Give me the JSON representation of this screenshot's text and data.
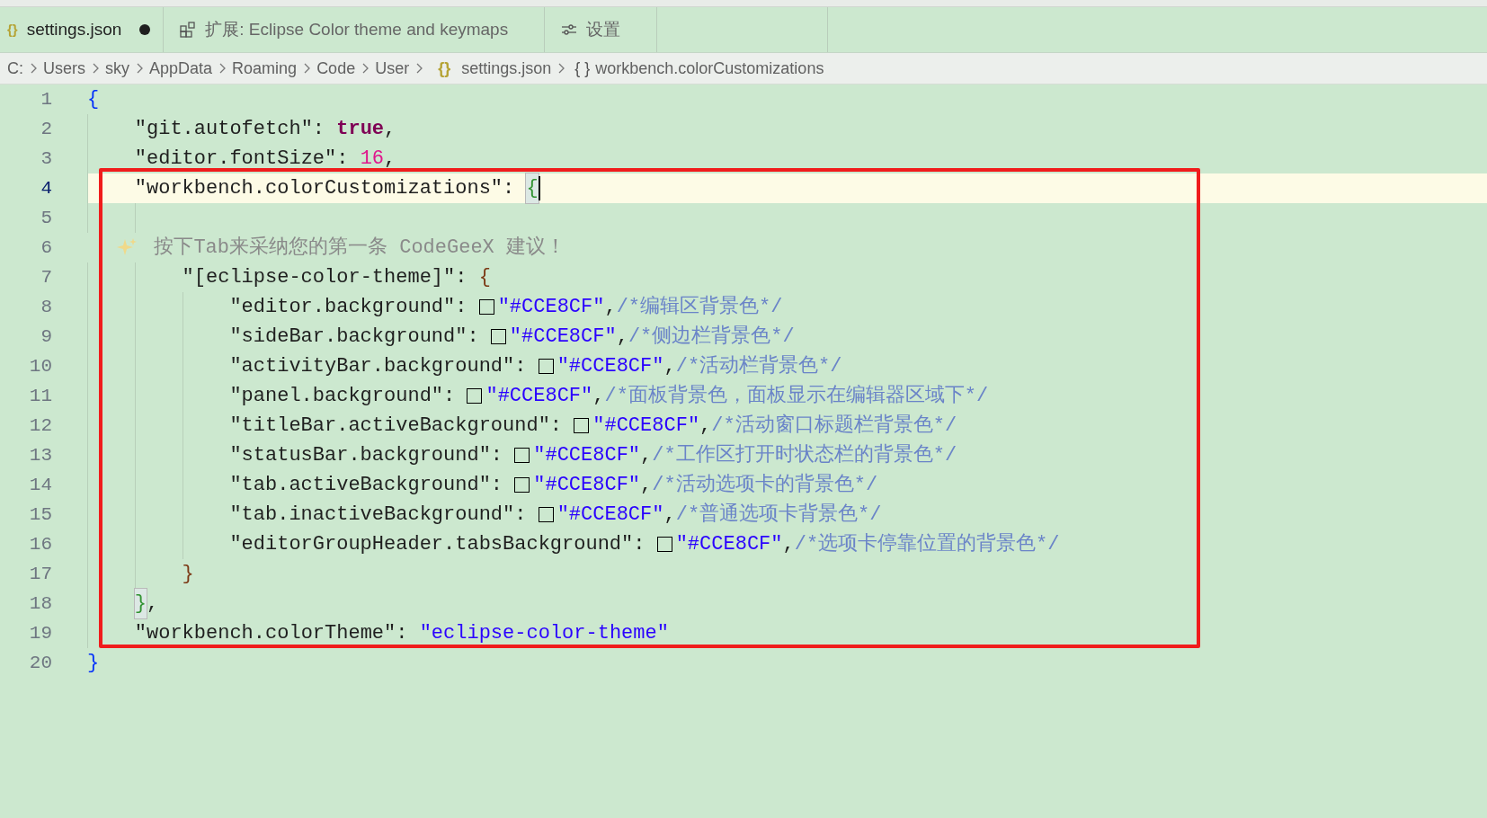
{
  "tabs": [
    {
      "kind": "file",
      "icon_text": "{}",
      "label": "settings.json",
      "selected": true,
      "modified": true
    },
    {
      "kind": "extension",
      "label": "扩展: Eclipse Color theme and keymaps",
      "selected": false,
      "modified": false
    },
    {
      "kind": "settings",
      "label": "设置",
      "selected": false,
      "modified": false
    }
  ],
  "breadcrumb": [
    {
      "label": "C:"
    },
    {
      "label": "Users"
    },
    {
      "label": "sky"
    },
    {
      "label": "AppData"
    },
    {
      "label": "Roaming"
    },
    {
      "label": "Code"
    },
    {
      "label": "User"
    },
    {
      "icon_text": "{}",
      "label": "settings.json"
    },
    {
      "icon_text": "{ }",
      "label": "workbench.colorCustomizations"
    }
  ],
  "lines": [
    {
      "number": "1",
      "kind": "root",
      "current": false,
      "tokens": [
        {
          "kind": "brace-outer",
          "text": "{",
          "matched": false
        }
      ]
    },
    {
      "number": "2",
      "kind": "member",
      "current": false,
      "tokens": [
        {
          "kind": "key",
          "text": "\"git.autofetch\""
        },
        {
          "kind": "punct",
          "text": ": "
        },
        {
          "kind": "bool",
          "text": "true"
        },
        {
          "kind": "punct",
          "text": ","
        }
      ]
    },
    {
      "number": "3",
      "kind": "member",
      "current": false,
      "tokens": [
        {
          "kind": "key",
          "text": "\"editor.fontSize\""
        },
        {
          "kind": "punct",
          "text": ": "
        },
        {
          "kind": "number",
          "text": "16"
        },
        {
          "kind": "punct",
          "text": ","
        }
      ]
    },
    {
      "number": "4",
      "kind": "member",
      "current": true,
      "tokens": [
        {
          "kind": "key",
          "text": "\"workbench.colorCustomizations\""
        },
        {
          "kind": "punct",
          "text": ": "
        },
        {
          "kind": "brace-mid",
          "text": "{",
          "matched": true
        }
      ]
    },
    {
      "number": "5",
      "kind": "nested",
      "current": false
    },
    {
      "number": "6",
      "kind": "suggestion",
      "current": false,
      "tokens": [
        {
          "kind": "sparkle"
        },
        {
          "kind": "ghost",
          "text": "按下Tab来采纳您的第一条 CodeGeeX 建议！"
        }
      ]
    },
    {
      "number": "7",
      "kind": "nested",
      "current": false,
      "tokens": [
        {
          "kind": "key",
          "text": "\"[eclipse-color-theme]\""
        },
        {
          "kind": "punct",
          "text": ": "
        },
        {
          "kind": "brace-inner",
          "text": "{",
          "matched": false
        }
      ]
    },
    {
      "number": "8",
      "kind": "inner",
      "current": false,
      "tokens": [
        {
          "kind": "key",
          "text": "\"editor.background\""
        },
        {
          "kind": "punct",
          "text": ": "
        },
        {
          "kind": "swatch",
          "color": "#cce8cf"
        },
        {
          "kind": "string",
          "text": "\"#CCE8CF\""
        },
        {
          "kind": "punct",
          "text": ","
        },
        {
          "kind": "comment",
          "text": "/*编辑区背景色*/"
        }
      ]
    },
    {
      "number": "9",
      "kind": "inner",
      "current": false,
      "tokens": [
        {
          "kind": "key",
          "text": "\"sideBar.background\""
        },
        {
          "kind": "punct",
          "text": ": "
        },
        {
          "kind": "swatch",
          "color": "#cce8cf"
        },
        {
          "kind": "string",
          "text": "\"#CCE8CF\""
        },
        {
          "kind": "punct",
          "text": ","
        },
        {
          "kind": "comment",
          "text": "/*侧边栏背景色*/"
        }
      ]
    },
    {
      "number": "10",
      "kind": "inner",
      "current": false,
      "tokens": [
        {
          "kind": "key",
          "text": "\"activityBar.background\""
        },
        {
          "kind": "punct",
          "text": ": "
        },
        {
          "kind": "swatch",
          "color": "#cce8cf"
        },
        {
          "kind": "string",
          "text": "\"#CCE8CF\""
        },
        {
          "kind": "punct",
          "text": ","
        },
        {
          "kind": "comment",
          "text": "/*活动栏背景色*/"
        }
      ]
    },
    {
      "number": "11",
      "kind": "inner",
      "current": false,
      "tokens": [
        {
          "kind": "key",
          "text": "\"panel.background\""
        },
        {
          "kind": "punct",
          "text": ": "
        },
        {
          "kind": "swatch",
          "color": "#cce8cf"
        },
        {
          "kind": "string",
          "text": "\"#CCE8CF\""
        },
        {
          "kind": "punct",
          "text": ","
        },
        {
          "kind": "comment",
          "text": "/*面板背景色，面板显示在编辑器区域下*/"
        }
      ]
    },
    {
      "number": "12",
      "kind": "inner",
      "current": false,
      "tokens": [
        {
          "kind": "key",
          "text": "\"titleBar.activeBackground\""
        },
        {
          "kind": "punct",
          "text": ": "
        },
        {
          "kind": "swatch",
          "color": "#cce8cf"
        },
        {
          "kind": "string",
          "text": "\"#CCE8CF\""
        },
        {
          "kind": "punct",
          "text": ","
        },
        {
          "kind": "comment",
          "text": "/*活动窗口标题栏背景色*/"
        }
      ]
    },
    {
      "number": "13",
      "kind": "inner",
      "current": false,
      "tokens": [
        {
          "kind": "key",
          "text": "\"statusBar.background\""
        },
        {
          "kind": "punct",
          "text": ": "
        },
        {
          "kind": "swatch",
          "color": "#cce8cf"
        },
        {
          "kind": "string",
          "text": "\"#CCE8CF\""
        },
        {
          "kind": "punct",
          "text": ","
        },
        {
          "kind": "comment",
          "text": "/*工作区打开时状态栏的背景色*/"
        }
      ]
    },
    {
      "number": "14",
      "kind": "inner",
      "current": false,
      "tokens": [
        {
          "kind": "key",
          "text": "\"tab.activeBackground\""
        },
        {
          "kind": "punct",
          "text": ": "
        },
        {
          "kind": "swatch",
          "color": "#cce8cf"
        },
        {
          "kind": "string",
          "text": "\"#CCE8CF\""
        },
        {
          "kind": "punct",
          "text": ","
        },
        {
          "kind": "comment",
          "text": "/*活动选项卡的背景色*/"
        }
      ]
    },
    {
      "number": "15",
      "kind": "inner",
      "current": false,
      "tokens": [
        {
          "kind": "key",
          "text": "\"tab.inactiveBackground\""
        },
        {
          "kind": "punct",
          "text": ": "
        },
        {
          "kind": "swatch",
          "color": "#cce8cf"
        },
        {
          "kind": "string",
          "text": "\"#CCE8CF\""
        },
        {
          "kind": "punct",
          "text": ","
        },
        {
          "kind": "comment",
          "text": "/*普通选项卡背景色*/"
        }
      ]
    },
    {
      "number": "16",
      "kind": "inner",
      "current": false,
      "tokens": [
        {
          "kind": "key",
          "text": "\"editorGroupHeader.tabsBackground\""
        },
        {
          "kind": "punct",
          "text": ": "
        },
        {
          "kind": "swatch",
          "color": "#cce8cf"
        },
        {
          "kind": "string",
          "text": "\"#CCE8CF\""
        },
        {
          "kind": "punct",
          "text": ","
        },
        {
          "kind": "comment",
          "text": "/*选项卡停靠位置的背景色*/"
        }
      ]
    },
    {
      "number": "17",
      "kind": "nested",
      "current": false,
      "tokens": [
        {
          "kind": "brace-inner",
          "text": "}",
          "matched": false
        }
      ]
    },
    {
      "number": "18",
      "kind": "member",
      "current": false,
      "tokens": [
        {
          "kind": "brace-mid",
          "text": "}",
          "matched": true
        },
        {
          "kind": "punct",
          "text": ","
        }
      ]
    },
    {
      "number": "19",
      "kind": "member",
      "current": false,
      "tokens": [
        {
          "kind": "key",
          "text": "\"workbench.colorTheme\""
        },
        {
          "kind": "punct",
          "text": ": "
        },
        {
          "kind": "string",
          "text": "\"eclipse-color-theme\""
        }
      ]
    },
    {
      "number": "20",
      "kind": "root",
      "current": false,
      "tokens": [
        {
          "kind": "brace-outer",
          "text": "}",
          "matched": false
        }
      ]
    }
  ]
}
